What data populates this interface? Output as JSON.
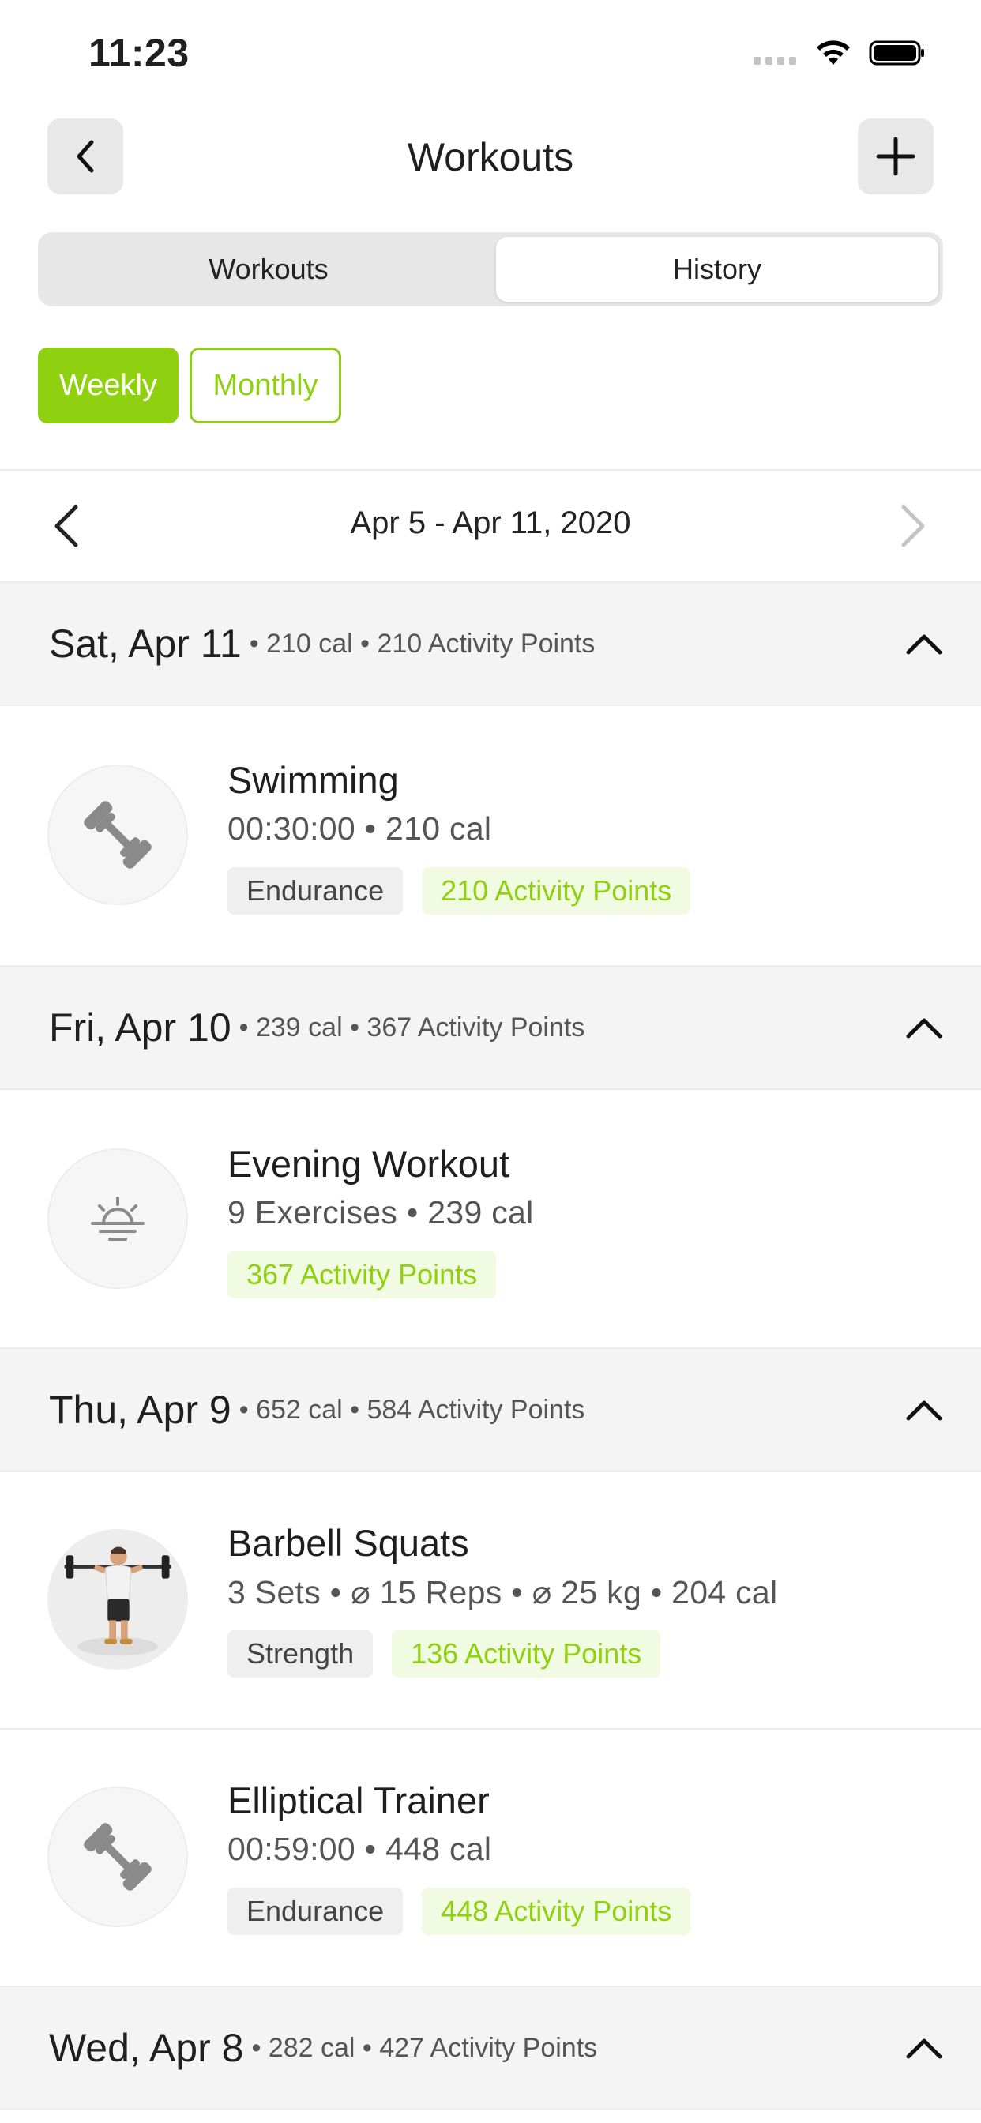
{
  "status_bar": {
    "time": "11:23"
  },
  "nav": {
    "title": "Workouts"
  },
  "segments": {
    "workouts": "Workouts",
    "history": "History"
  },
  "filters": {
    "weekly": "Weekly",
    "monthly": "Monthly"
  },
  "week": {
    "range": "Apr 5 - Apr 11, 2020"
  },
  "days": [
    {
      "title": "Sat, Apr 11",
      "meta": "• 210 cal • 210 Activity Points",
      "workouts": [
        {
          "title": "Swimming",
          "sub": "00:30:00 • 210 cal",
          "icon": "dumbbell-icon",
          "tags": [
            "Endurance",
            "210 Activity Points"
          ]
        }
      ]
    },
    {
      "title": "Fri, Apr 10",
      "meta": "• 239 cal • 367 Activity Points",
      "workouts": [
        {
          "title": "Evening Workout",
          "sub": "9 Exercises • 239 cal",
          "icon": "sunset-icon",
          "tags": [
            "367 Activity Points"
          ]
        }
      ]
    },
    {
      "title": "Thu, Apr 9",
      "meta": "• 652 cal • 584 Activity Points",
      "workouts": [
        {
          "title": "Barbell Squats",
          "sub": "3 Sets • ⌀ 15 Reps • ⌀ 25 kg • 204 cal",
          "icon": "barbell-squat-figure",
          "tags": [
            "Strength",
            "136 Activity Points"
          ]
        },
        {
          "title": "Elliptical Trainer",
          "sub": "00:59:00 • 448 cal",
          "icon": "dumbbell-icon",
          "tags": [
            "Endurance",
            "448 Activity Points"
          ]
        }
      ]
    },
    {
      "title": "Wed, Apr 8",
      "meta": "• 282 cal • 427 Activity Points",
      "workouts": []
    }
  ],
  "colors": {
    "accent": "#8fd011",
    "header_bg": "#f4f4f4",
    "tag_gray": "#efefef",
    "tag_green_bg": "#f1fbe2"
  }
}
